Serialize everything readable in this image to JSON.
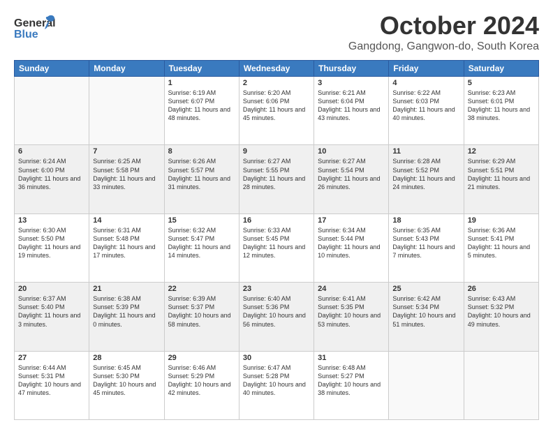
{
  "header": {
    "logo_line1": "General",
    "logo_line2": "Blue",
    "month": "October 2024",
    "location": "Gangdong, Gangwon-do, South Korea"
  },
  "days_of_week": [
    "Sunday",
    "Monday",
    "Tuesday",
    "Wednesday",
    "Thursday",
    "Friday",
    "Saturday"
  ],
  "weeks": [
    [
      {
        "day": "",
        "info": ""
      },
      {
        "day": "",
        "info": ""
      },
      {
        "day": "1",
        "info": "Sunrise: 6:19 AM\nSunset: 6:07 PM\nDaylight: 11 hours and 48 minutes."
      },
      {
        "day": "2",
        "info": "Sunrise: 6:20 AM\nSunset: 6:06 PM\nDaylight: 11 hours and 45 minutes."
      },
      {
        "day": "3",
        "info": "Sunrise: 6:21 AM\nSunset: 6:04 PM\nDaylight: 11 hours and 43 minutes."
      },
      {
        "day": "4",
        "info": "Sunrise: 6:22 AM\nSunset: 6:03 PM\nDaylight: 11 hours and 40 minutes."
      },
      {
        "day": "5",
        "info": "Sunrise: 6:23 AM\nSunset: 6:01 PM\nDaylight: 11 hours and 38 minutes."
      }
    ],
    [
      {
        "day": "6",
        "info": "Sunrise: 6:24 AM\nSunset: 6:00 PM\nDaylight: 11 hours and 36 minutes."
      },
      {
        "day": "7",
        "info": "Sunrise: 6:25 AM\nSunset: 5:58 PM\nDaylight: 11 hours and 33 minutes."
      },
      {
        "day": "8",
        "info": "Sunrise: 6:26 AM\nSunset: 5:57 PM\nDaylight: 11 hours and 31 minutes."
      },
      {
        "day": "9",
        "info": "Sunrise: 6:27 AM\nSunset: 5:55 PM\nDaylight: 11 hours and 28 minutes."
      },
      {
        "day": "10",
        "info": "Sunrise: 6:27 AM\nSunset: 5:54 PM\nDaylight: 11 hours and 26 minutes."
      },
      {
        "day": "11",
        "info": "Sunrise: 6:28 AM\nSunset: 5:52 PM\nDaylight: 11 hours and 24 minutes."
      },
      {
        "day": "12",
        "info": "Sunrise: 6:29 AM\nSunset: 5:51 PM\nDaylight: 11 hours and 21 minutes."
      }
    ],
    [
      {
        "day": "13",
        "info": "Sunrise: 6:30 AM\nSunset: 5:50 PM\nDaylight: 11 hours and 19 minutes."
      },
      {
        "day": "14",
        "info": "Sunrise: 6:31 AM\nSunset: 5:48 PM\nDaylight: 11 hours and 17 minutes."
      },
      {
        "day": "15",
        "info": "Sunrise: 6:32 AM\nSunset: 5:47 PM\nDaylight: 11 hours and 14 minutes."
      },
      {
        "day": "16",
        "info": "Sunrise: 6:33 AM\nSunset: 5:45 PM\nDaylight: 11 hours and 12 minutes."
      },
      {
        "day": "17",
        "info": "Sunrise: 6:34 AM\nSunset: 5:44 PM\nDaylight: 11 hours and 10 minutes."
      },
      {
        "day": "18",
        "info": "Sunrise: 6:35 AM\nSunset: 5:43 PM\nDaylight: 11 hours and 7 minutes."
      },
      {
        "day": "19",
        "info": "Sunrise: 6:36 AM\nSunset: 5:41 PM\nDaylight: 11 hours and 5 minutes."
      }
    ],
    [
      {
        "day": "20",
        "info": "Sunrise: 6:37 AM\nSunset: 5:40 PM\nDaylight: 11 hours and 3 minutes."
      },
      {
        "day": "21",
        "info": "Sunrise: 6:38 AM\nSunset: 5:39 PM\nDaylight: 11 hours and 0 minutes."
      },
      {
        "day": "22",
        "info": "Sunrise: 6:39 AM\nSunset: 5:37 PM\nDaylight: 10 hours and 58 minutes."
      },
      {
        "day": "23",
        "info": "Sunrise: 6:40 AM\nSunset: 5:36 PM\nDaylight: 10 hours and 56 minutes."
      },
      {
        "day": "24",
        "info": "Sunrise: 6:41 AM\nSunset: 5:35 PM\nDaylight: 10 hours and 53 minutes."
      },
      {
        "day": "25",
        "info": "Sunrise: 6:42 AM\nSunset: 5:34 PM\nDaylight: 10 hours and 51 minutes."
      },
      {
        "day": "26",
        "info": "Sunrise: 6:43 AM\nSunset: 5:32 PM\nDaylight: 10 hours and 49 minutes."
      }
    ],
    [
      {
        "day": "27",
        "info": "Sunrise: 6:44 AM\nSunset: 5:31 PM\nDaylight: 10 hours and 47 minutes."
      },
      {
        "day": "28",
        "info": "Sunrise: 6:45 AM\nSunset: 5:30 PM\nDaylight: 10 hours and 45 minutes."
      },
      {
        "day": "29",
        "info": "Sunrise: 6:46 AM\nSunset: 5:29 PM\nDaylight: 10 hours and 42 minutes."
      },
      {
        "day": "30",
        "info": "Sunrise: 6:47 AM\nSunset: 5:28 PM\nDaylight: 10 hours and 40 minutes."
      },
      {
        "day": "31",
        "info": "Sunrise: 6:48 AM\nSunset: 5:27 PM\nDaylight: 10 hours and 38 minutes."
      },
      {
        "day": "",
        "info": ""
      },
      {
        "day": "",
        "info": ""
      }
    ]
  ]
}
